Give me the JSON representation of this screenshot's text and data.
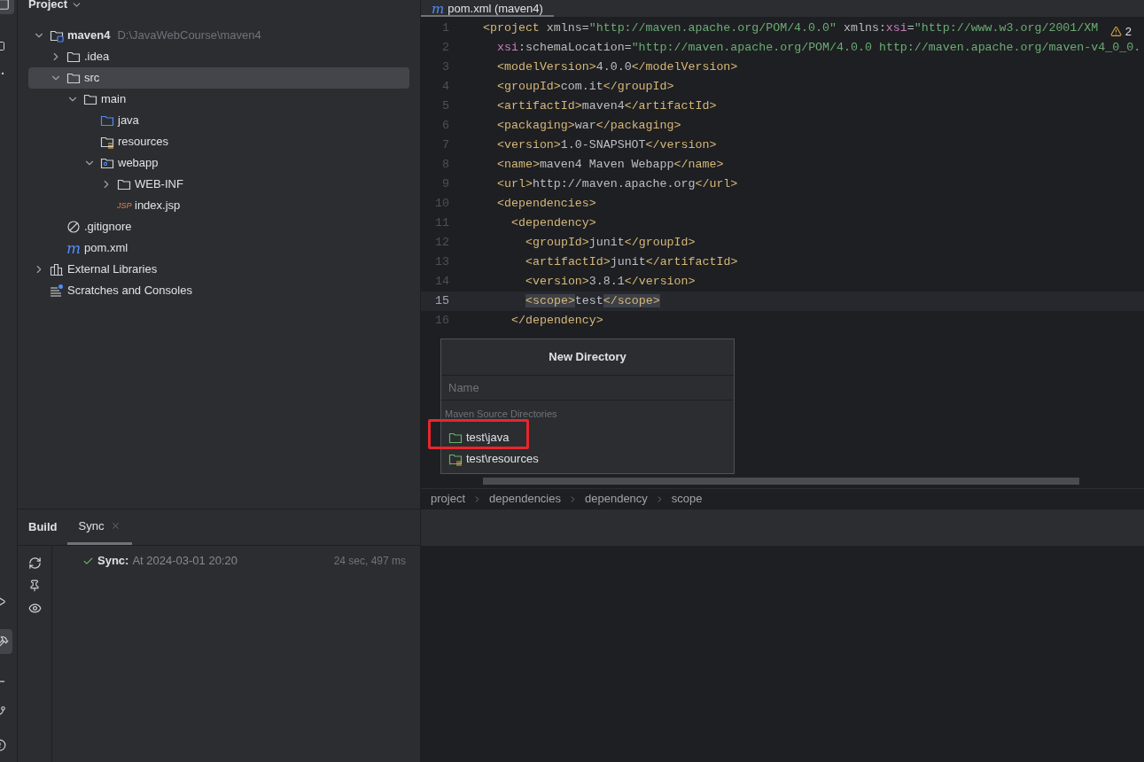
{
  "project_panel": {
    "title": "Project",
    "tree": [
      {
        "label": "maven4",
        "path": "D:\\JavaWebCourse\\maven4",
        "kind": "module",
        "expanded": true,
        "selected": false,
        "children": [
          {
            "label": ".idea",
            "kind": "folder",
            "expanded": false,
            "selected": false
          },
          {
            "label": "src",
            "kind": "folder",
            "expanded": true,
            "selected": true,
            "children": [
              {
                "label": "main",
                "kind": "folder",
                "expanded": true,
                "selected": false,
                "children": [
                  {
                    "label": "java",
                    "kind": "source",
                    "selected": false
                  },
                  {
                    "label": "resources",
                    "kind": "resources",
                    "selected": false
                  },
                  {
                    "label": "webapp",
                    "kind": "web",
                    "expanded": true,
                    "selected": false,
                    "children": [
                      {
                        "label": "WEB-INF",
                        "kind": "folder",
                        "expanded": false,
                        "selected": false
                      },
                      {
                        "label": "index.jsp",
                        "kind": "jsp",
                        "icon_text": "JSP",
                        "selected": false
                      }
                    ]
                  }
                ]
              }
            ]
          },
          {
            "label": ".gitignore",
            "kind": "ignore",
            "selected": false
          },
          {
            "label": "pom.xml",
            "kind": "maven",
            "icon_text": "m",
            "selected": false
          }
        ]
      },
      {
        "label": "External Libraries",
        "kind": "libraries",
        "expanded": false,
        "selected": false
      },
      {
        "label": "Scratches and Consoles",
        "kind": "scratches",
        "selected": false
      }
    ]
  },
  "editor": {
    "tab": {
      "icon_text": "m",
      "label": "pom.xml (maven4)"
    },
    "warnings": "2",
    "lines": [
      {
        "number": "1",
        "current": false,
        "segments": [
          {
            "kind": "tag",
            "text": "<project"
          },
          {
            "kind": "attr",
            "text": " xmlns"
          },
          {
            "kind": "text",
            "text": "="
          },
          {
            "kind": "value",
            "text": "\"http://maven.apache.org/POM/4.0.0\""
          },
          {
            "kind": "attr",
            "text": " xmlns:"
          },
          {
            "kind": "ns",
            "text": "xsi"
          },
          {
            "kind": "text",
            "text": "="
          },
          {
            "kind": "value",
            "text": "\"http://www.w3.org/2001/XM"
          }
        ],
        "children": [
          {
            "number": "2",
            "current": false,
            "segments": [
              {
                "kind": "ns",
                "text": "xsi"
              },
              {
                "kind": "text",
                "text": ":"
              },
              {
                "kind": "attr",
                "text": "schemaLocation"
              },
              {
                "kind": "text",
                "text": "="
              },
              {
                "kind": "value",
                "text": "\"http://maven.apache.org/POM/4.0.0 http://maven.apache.org/maven-v4_0_0."
              }
            ]
          },
          {
            "number": "3",
            "current": false,
            "segments": [
              {
                "kind": "tag",
                "text": "<modelVersion>"
              },
              {
                "kind": "text",
                "text": "4.0.0"
              },
              {
                "kind": "tag",
                "text": "</modelVersion>"
              }
            ]
          },
          {
            "number": "4",
            "current": false,
            "segments": [
              {
                "kind": "tag",
                "text": "<groupId>"
              },
              {
                "kind": "text",
                "text": "com.it"
              },
              {
                "kind": "tag",
                "text": "</groupId>"
              }
            ]
          },
          {
            "number": "5",
            "current": false,
            "segments": [
              {
                "kind": "tag",
                "text": "<artifactId>"
              },
              {
                "kind": "text",
                "text": "maven4"
              },
              {
                "kind": "tag",
                "text": "</artifactId>"
              }
            ]
          },
          {
            "number": "6",
            "current": false,
            "segments": [
              {
                "kind": "tag",
                "text": "<packaging>"
              },
              {
                "kind": "text",
                "text": "war"
              },
              {
                "kind": "tag",
                "text": "</packaging>"
              }
            ]
          },
          {
            "number": "7",
            "current": false,
            "segments": [
              {
                "kind": "tag",
                "text": "<version>"
              },
              {
                "kind": "text",
                "text": "1.0-SNAPSHOT"
              },
              {
                "kind": "tag",
                "text": "</version>"
              }
            ]
          },
          {
            "number": "8",
            "current": false,
            "segments": [
              {
                "kind": "tag",
                "text": "<name>"
              },
              {
                "kind": "text",
                "text": "maven4 Maven Webapp"
              },
              {
                "kind": "tag",
                "text": "</name>"
              }
            ]
          },
          {
            "number": "9",
            "current": false,
            "segments": [
              {
                "kind": "tag",
                "text": "<url>"
              },
              {
                "kind": "text",
                "text": "http://maven.apache.org"
              },
              {
                "kind": "tag",
                "text": "</url>"
              }
            ]
          },
          {
            "number": "10",
            "current": false,
            "segments": [
              {
                "kind": "tag",
                "text": "<dependencies>"
              }
            ],
            "children": [
              {
                "number": "11",
                "current": false,
                "segments": [
                  {
                    "kind": "tag",
                    "text": "<dependency>"
                  }
                ],
                "children": [
                  {
                    "number": "12",
                    "current": false,
                    "segments": [
                      {
                        "kind": "tag",
                        "text": "<groupId>"
                      },
                      {
                        "kind": "text",
                        "text": "junit"
                      },
                      {
                        "kind": "tag",
                        "text": "</groupId>"
                      }
                    ]
                  },
                  {
                    "number": "13",
                    "current": false,
                    "segments": [
                      {
                        "kind": "tag",
                        "text": "<artifactId>"
                      },
                      {
                        "kind": "text",
                        "text": "junit"
                      },
                      {
                        "kind": "tag",
                        "text": "</artifactId>"
                      }
                    ]
                  },
                  {
                    "number": "14",
                    "current": false,
                    "segments": [
                      {
                        "kind": "tag",
                        "text": "<version>"
                      },
                      {
                        "kind": "text",
                        "text": "3.8.1"
                      },
                      {
                        "kind": "tag",
                        "text": "</version>"
                      }
                    ]
                  },
                  {
                    "number": "15",
                    "current": true,
                    "segments": [
                      {
                        "kind": "tag-match",
                        "text": "<scope>"
                      },
                      {
                        "kind": "text",
                        "text": "test"
                      },
                      {
                        "kind": "tag-match",
                        "text": "</scope>"
                      }
                    ]
                  }
                ]
              },
              {
                "number": "16",
                "current": false,
                "segments": [
                  {
                    "kind": "tag",
                    "text": "</dependency>"
                  }
                ]
              }
            ]
          }
        ]
      }
    ],
    "breadcrumbs": [
      "project",
      "dependencies",
      "dependency",
      "scope"
    ]
  },
  "popup": {
    "title": "New Directory",
    "placeholder": "Name",
    "section": "Maven Source Directories",
    "items": [
      {
        "label": "test\\java",
        "kind": "source-test",
        "highlighted": true
      },
      {
        "label": "test\\resources",
        "kind": "resources-test",
        "highlighted": false
      }
    ]
  },
  "build_panel": {
    "title": "Build",
    "tabs": [
      {
        "label": "Sync",
        "selected": true
      }
    ],
    "events": [
      {
        "succeeded": true,
        "label": "Sync:",
        "text": "At 2024-03-01 20:20",
        "duration": "24 sec, 497 ms"
      }
    ]
  }
}
